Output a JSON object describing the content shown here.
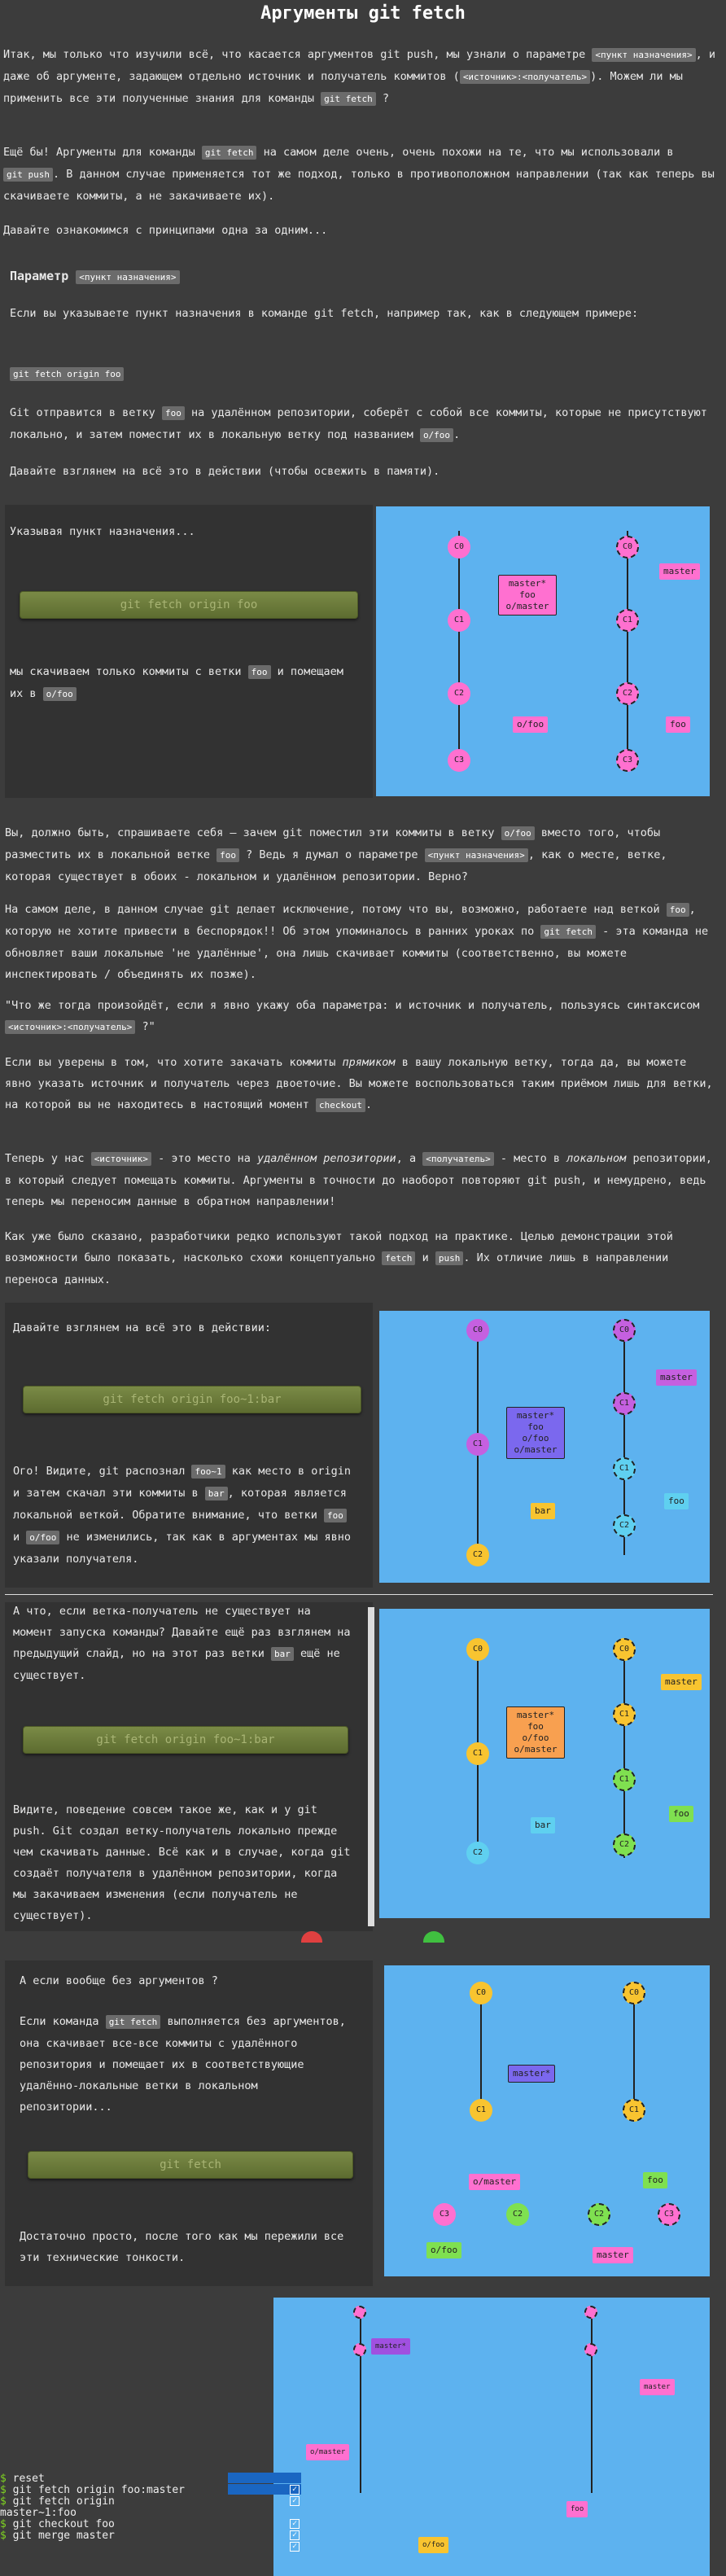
{
  "title": "Аргументы git fetch",
  "intro": {
    "p1_a": "Итак, мы только что изучили всё, что касается аргументов git push, мы узнали о параметре",
    "p1_code1": "<пункт назначения>",
    "p1_b": ", и даже об аргументе, задающем отдельно источник и получатель коммитов (",
    "p1_code2": "<источник>:<получатель>",
    "p1_c": "). Можем ли мы применить все эти полученные знания для команды",
    "p1_code3": "git fetch",
    "p1_d": "?",
    "p2_a": "Ещё бы! Аргументы для команды",
    "p2_code1": "git fetch",
    "p2_b": "на самом деле очень, очень похожи на те, что мы использовали в",
    "p2_code2": "git push",
    "p2_c": ". В данном случае применяется тот же подход, только в противоположном направлении (так как теперь вы скачиваете коммиты, а не закачиваете их).",
    "p3": "Давайте ознакомимся с принципами одна за одним..."
  },
  "section1": {
    "heading": "Параметр",
    "heading_code": "<пункт назначения>",
    "p1": "Если вы указываете пункт назначения в команде git fetch, например так, как в следующем примере:",
    "code_example": "git fetch origin foo",
    "p2_a": "Git отправится в ветку",
    "p2_code1": "foo",
    "p2_b": "на удалённом репозитории, соберёт с собой все коммиты, которые не присутствуют локально, и затем поместит их в локальную ветку под названием",
    "p2_code2": "o/foo",
    "p2_c": ".",
    "p3": "Давайте взглянем на всё это в действии (чтобы освежить в памяти)."
  },
  "demo1": {
    "text_top": "Указывая пункт назначения...",
    "button": "git fetch origin foo",
    "text_bottom_a": "мы скачиваем только коммиты с ветки",
    "text_code1": "foo",
    "text_bottom_b": "и помещаем их в",
    "text_code2": "o/foo",
    "local": {
      "commits": [
        "C0",
        "C1",
        "C2",
        "C3"
      ],
      "label_main": "master*",
      "label_foo": "foo",
      "label_om": "o/master",
      "label_ofoo": "o/foo"
    },
    "remote": {
      "commits": [
        "C0",
        "C1",
        "C2",
        "C3"
      ],
      "label_master": "master",
      "label_foo": "foo"
    }
  },
  "section2": {
    "p1_a": "Вы, должно быть, спрашиваете себя — зачем git поместил эти коммиты в ветку",
    "p1_code1": "o/foo",
    "p1_b": "вместо того, чтобы разместить их в локальной ветке",
    "p1_code2": "foo",
    "p1_c": "? Ведь я думал о параметре",
    "p1_code3": "<пункт назначения>",
    "p1_d": ", как о месте, ветке, которая существует в обоих - локальном и удалённом репозитории. Верно?",
    "p2_a": "На самом деле, в данном случае git делает исключение, потому что вы, возможно, работаете над веткой",
    "p2_code1": "foo",
    "p2_b": ", которую не хотите привести в беспорядок!! Об этом упоминалось в ранних уроках по",
    "p2_code2": "git fetch",
    "p2_c": "- эта команда не обновляет ваши локальные 'не удалённые', она лишь скачивает коммиты (соответственно, вы можете инспектировать / объединять их позже).",
    "p3_a": "\"Что же тогда произойдёт, если я явно укажу оба параметра: и источник и получатель, пользуясь синтаксисом",
    "p3_code": "<источник>:<получатель>",
    "p3_b": "?\"",
    "p4_a": "Если вы уверены в том, что хотите закачать коммиты",
    "p4_em": "прямиком",
    "p4_b": "в вашу локальную ветку, тогда да, вы можете явно указать источник и получатель через двоеточие. Вы можете воспользоваться таким приёмом лишь для ветки, на которой вы не находитесь в настоящий момент",
    "p4_code": "checkout",
    "p4_c": ".",
    "p5_a": "Теперь у нас",
    "p5_code1": "<источник>",
    "p5_b": "- это место на",
    "p5_em1": "удалённом репозитории",
    "p5_c": ", а",
    "p5_code2": "<получатель>",
    "p5_d": "- место в",
    "p5_em2": "локальном",
    "p5_e": "репозитории, в который следует помещать коммиты. Аргументы в точности до наоборот повторяют git push, и немудрено, ведь теперь мы переносим данные в обратном направлении!",
    "p6_a": "Как уже было сказано, разработчики редко используют такой подход на практике. Целью демонстрации этой возможности было показать, насколько схожи концептуально",
    "p6_code1": "fetch",
    "p6_b": "и",
    "p6_code2": "push",
    "p6_c": ". Их отличие лишь в направлении переноса данных."
  },
  "demo2": {
    "text_top": "Давайте взглянем на всё это в действии:",
    "button": "git fetch origin foo~1:bar",
    "text_a": "Ого! Видите, git распознал",
    "code1": "foo~1",
    "text_b": "как место в origin и затем скачал эти коммиты в",
    "code2": "bar",
    "text_c": ", которая является локальной веткой. Обратите внимание, что ветки",
    "code3": "foo",
    "text_d": "и",
    "code4": "o/foo",
    "text_e": "не изменились, так как в аргументах мы явно указали получателя.",
    "local_label": "master*\nfoo\no/foo\no/master",
    "bar": "bar",
    "remote_master": "master",
    "remote_foo": "foo",
    "commits": [
      "C0",
      "C1",
      "C2"
    ]
  },
  "demo3": {
    "text_top_a": "А что, если ветка-получатель не существует на момент запуска команды? Давайте ещё раз взглянем на предыдущий слайд, но на этот раз ветки",
    "code1": "bar",
    "text_top_b": "ещё не существует.",
    "button": "git fetch origin foo~1:bar",
    "text_bottom": "Видите, поведение совсем такое же, как и у git push. Git создал ветку-получатель локально прежде чем скачивать данные. Всё как и в случае, когда git создаёт получателя в удалённом репозитории, когда мы закачиваем изменения (если получатель не существует).",
    "local_label": "master*\nfoo\no/foo\no/master",
    "bar": "bar",
    "remote_master": "master",
    "remote_foo": "foo",
    "commits": [
      "C0",
      "C1",
      "C2"
    ]
  },
  "demo4": {
    "text_top": "А если вообще без аргументов ?",
    "text_a": "Если команда",
    "code1": "git fetch",
    "text_b": "выполняется без аргументов, она скачивает все-все коммиты с удалённого репозитория и помещает их в соответствующие удалённо-локальные ветки в локальном репозитории...",
    "button": "git fetch",
    "text_bottom": "Достаточно просто, после того как мы пережили все эти технические тонкости.",
    "local_master": "master*",
    "o_master": "o/master",
    "o_foo": "o/foo",
    "remote_master": "master",
    "remote_foo": "foo",
    "commits": [
      "C0",
      "C1",
      "C2",
      "C3"
    ]
  },
  "terminal": {
    "lines": [
      "reset",
      "git fetch origin foo:master",
      "git fetch origin master~1:foo",
      "git checkout foo",
      "git merge master"
    ],
    "wrap": "master~1:foo"
  },
  "level_viz": {
    "labels": [
      "master*",
      "o/master",
      "foo",
      "o/foo",
      "master",
      "foo"
    ]
  },
  "colors": {
    "background": "#3c3c3c",
    "viz": "#5db2ef",
    "pink": "#ff70d0",
    "orange": "#f8c430",
    "purple": "#c560e0",
    "violet": "#7b68ee",
    "cyan": "#5fd0f0",
    "green": "#7fe050"
  }
}
